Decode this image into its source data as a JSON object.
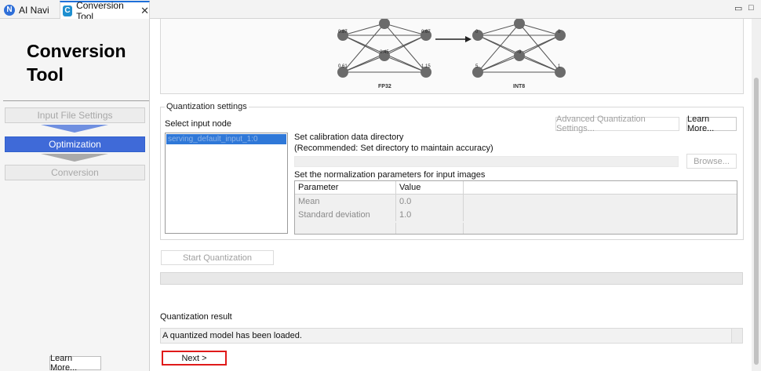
{
  "tabs": {
    "ai_navi": "AI Navi",
    "conversion_tool": "Conversion Tool",
    "close_glyph": "✕"
  },
  "sidebar": {
    "title": "Conversion Tool",
    "steps": [
      {
        "label": "Input File Settings",
        "state": "disabled"
      },
      {
        "label": "Optimization",
        "state": "active"
      },
      {
        "label": "Conversion",
        "state": "disabled"
      }
    ],
    "learn_more": "Learn More..."
  },
  "diagram": {
    "left_caption": "FP32",
    "right_caption": "INT8",
    "fp32_values": [
      "0.87",
      "0.67",
      "0.45",
      "0.61",
      "1.15"
    ],
    "int8_values": [
      "0",
      "0",
      "-9",
      "5",
      "1"
    ]
  },
  "quantization_settings": {
    "group_title": "Quantization settings",
    "select_input_node": "Select input node",
    "advanced_button": "Advanced Quantization Settings...",
    "learn_more_button": "Learn More...",
    "input_nodes": [
      "serving_default_input_1:0"
    ],
    "calibration_label": "Set calibration data directory",
    "calibration_hint": "(Recommended: Set directory to maintain accuracy)",
    "browse_button": "Browse...",
    "normalization_label": "Set the normalization parameters for input images",
    "table": {
      "headers": [
        "Parameter",
        "Value"
      ],
      "rows": [
        [
          "Mean",
          "0.0"
        ],
        [
          "Standard deviation",
          "1.0"
        ]
      ]
    }
  },
  "start_quantization": "Start Quantization",
  "quantization_result": {
    "label": "Quantization result",
    "message": "A quantized model has been loaded."
  },
  "next_button": "Next >",
  "colors": {
    "accent": "#3f6ad8",
    "highlight_border": "#e01a1a",
    "node_gray": "#6b6b6b"
  }
}
